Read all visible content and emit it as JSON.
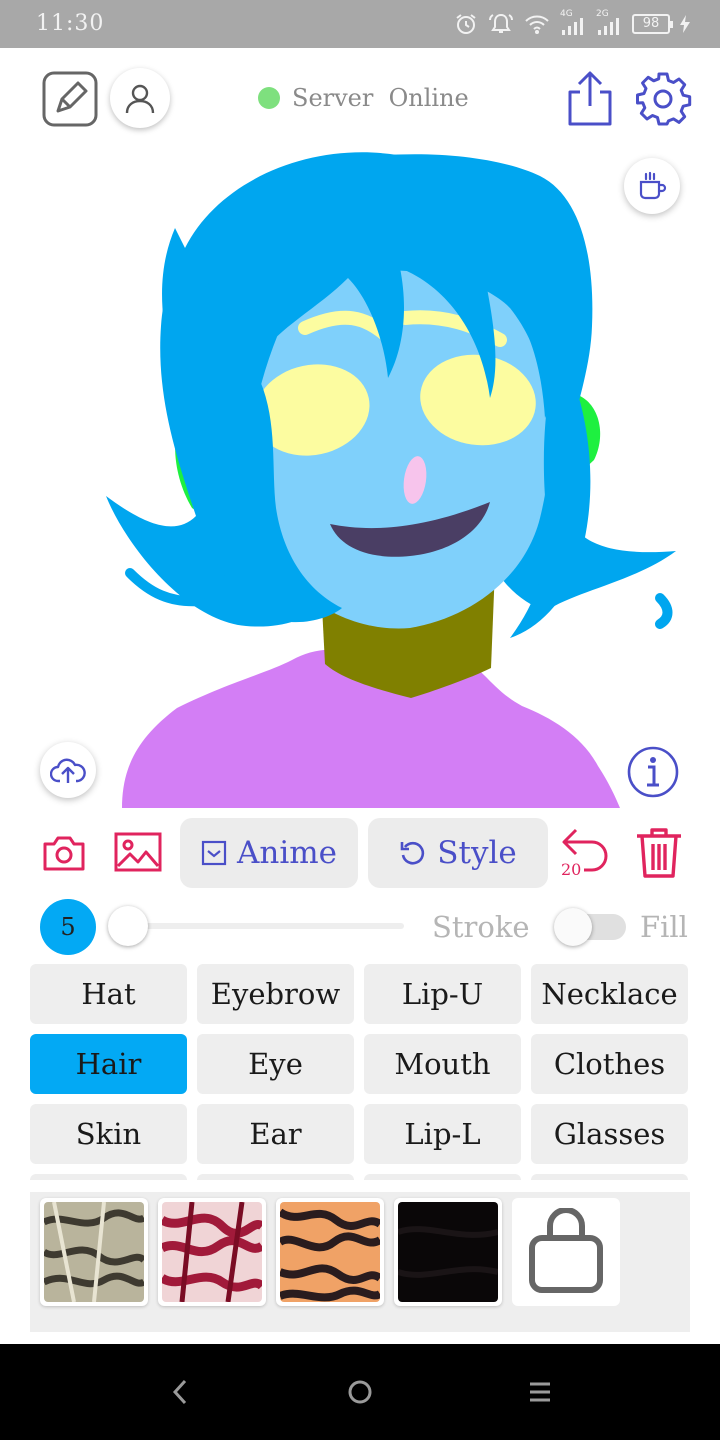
{
  "status_bar": {
    "time": "11:30",
    "signal_1": "4G",
    "signal_2": "2G",
    "battery": "98"
  },
  "header": {
    "server_status": "Server  Online",
    "server_status_color": "#7ee07e"
  },
  "toolbar": {
    "anime_label": "Anime",
    "style_label": "Style",
    "undo_count": "20"
  },
  "brush": {
    "size": "5",
    "size_slider_value": 0,
    "stroke_label": "Stroke",
    "fill_label": "Fill",
    "fill_enabled": false
  },
  "categories": [
    {
      "label": "Hat",
      "active": false
    },
    {
      "label": "Eyebrow",
      "active": false
    },
    {
      "label": "Lip-U",
      "active": false
    },
    {
      "label": "Necklace",
      "active": false
    },
    {
      "label": "Hair",
      "active": true
    },
    {
      "label": "Eye",
      "active": false
    },
    {
      "label": "Mouth",
      "active": false
    },
    {
      "label": "Clothes",
      "active": false
    },
    {
      "label": "Skin",
      "active": false
    },
    {
      "label": "Ear",
      "active": false
    },
    {
      "label": "Lip-L",
      "active": false
    },
    {
      "label": "Glasses",
      "active": false
    }
  ],
  "colors": {
    "accent": "#03a9f4",
    "icon_indigo": "#4a4fc8",
    "icon_pink": "#e0245e"
  },
  "icons": [
    "edit-icon",
    "user-icon",
    "share-icon",
    "settings-icon",
    "coffee-icon",
    "cloud-upload-icon",
    "info-icon",
    "camera-icon",
    "image-icon",
    "checkbox-icon",
    "undo-icon",
    "trash-icon",
    "shopping-bag-icon",
    "back-icon",
    "home-icon",
    "menu-icon"
  ]
}
